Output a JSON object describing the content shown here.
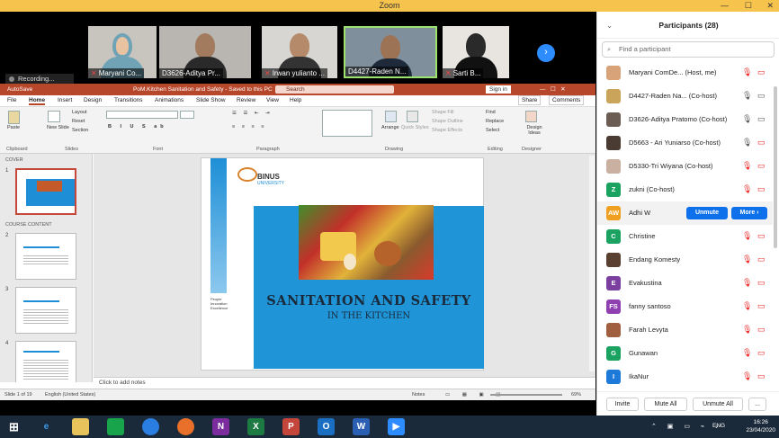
{
  "zoom": {
    "title": "Zoom",
    "minimize": "—",
    "maximize": "☐",
    "close": "✕"
  },
  "video_strip": {
    "participants": [
      {
        "name": "Maryani Co..."
      },
      {
        "name": "D3626-Aditya Pr..."
      },
      {
        "name": "Irwan yulianto ..."
      },
      {
        "name": "D4427-Raden N..."
      },
      {
        "name": "Sarti B..."
      }
    ],
    "next_arrow": "›",
    "recording": "Recording..."
  },
  "ppt": {
    "autosave": "AutoSave",
    "doc_title": "PoM.Kitchen Sanitation and  Safety  -  Saved to this PC",
    "search_placeholder": "Search",
    "sign_in": "Sign in",
    "tabs": [
      "File",
      "Home",
      "Insert",
      "Design",
      "Transitions",
      "Animations",
      "Slide Show",
      "Review",
      "View",
      "Help"
    ],
    "share": "Share",
    "comments": "Comments",
    "groups": {
      "clipboard": "Clipboard",
      "slides": "Slides",
      "font": "Font",
      "paragraph": "Paragraph",
      "drawing": "Drawing",
      "editing": "Editing",
      "designer": "Designer"
    },
    "ribbon_buttons": {
      "paste": "Paste",
      "new_slide": "New Slide",
      "layout": "Layout",
      "reset": "Reset",
      "section": "Section",
      "arrange": "Arrange",
      "quick_styles": "Quick Styles",
      "shape_fill": "Shape Fill",
      "shape_outline": "Shape Outline",
      "shape_effects": "Shape Effects",
      "find": "Find",
      "replace": "Replace",
      "select": "Select",
      "design_ideas": "Design Ideas"
    },
    "sections": [
      "COVER",
      "COURSE CONTENT"
    ],
    "slide_numbers": [
      "1",
      "2",
      "3",
      "4"
    ],
    "slide": {
      "logo_text": "BINUS",
      "logo_sub": "UNIVERSITY",
      "side_text": [
        "People",
        "Innovation",
        "Excellence"
      ],
      "title": "SANITATION AND  SAFETY",
      "subtitle": "IN THE KITCHEN"
    },
    "notes_placeholder": "Click to add notes",
    "status": {
      "slide": "Slide 1 of 19",
      "language": "English (United States)",
      "notes": "Notes",
      "zoom": "69%"
    }
  },
  "panel": {
    "title": "Participants (28)",
    "search_placeholder": "Find a participant",
    "rows": [
      {
        "initials": "",
        "color": "#d9a37a",
        "name": "Maryani ComDe... (Host, me)"
      },
      {
        "initials": "",
        "color": "#c9a45a",
        "name": "D4427-Raden Na... (Co-host)"
      },
      {
        "initials": "",
        "color": "#6b5d54",
        "name": "D3626-Aditya Pratomo (Co-host)"
      },
      {
        "initials": "",
        "color": "#4a3b33",
        "name": "D5663 - Ari Yuniarso (Co-host)"
      },
      {
        "initials": "",
        "color": "#c9b0a0",
        "name": "D5330-Tri Wiyana (Co-host)"
      },
      {
        "initials": "Z",
        "color": "#1aa260",
        "name": "zukni (Co-host)"
      },
      {
        "initials": "AW",
        "color": "#f0a020",
        "name": "Adhi W"
      },
      {
        "initials": "C",
        "color": "#1aa260",
        "name": "Christine"
      },
      {
        "initials": "",
        "color": "#5a4030",
        "name": "Endang Komesty"
      },
      {
        "initials": "E",
        "color": "#7b3fa0",
        "name": "Evakustina"
      },
      {
        "initials": "FS",
        "color": "#8e3fb0",
        "name": "fanny santoso"
      },
      {
        "initials": "",
        "color": "#a06040",
        "name": "Farah Levyta"
      },
      {
        "initials": "G",
        "color": "#1aa260",
        "name": "Gunawan"
      },
      {
        "initials": "I",
        "color": "#1e7ad8",
        "name": "IkaNur"
      }
    ],
    "unmute": "Unmute",
    "more": "More ›",
    "invite": "Invite",
    "mute_all": "Mute All",
    "unmute_all": "Unmute All",
    "ellipsis": "..."
  },
  "taskbar": {
    "lang": "ENG",
    "time": "16:26",
    "date": "23/04/2020"
  }
}
